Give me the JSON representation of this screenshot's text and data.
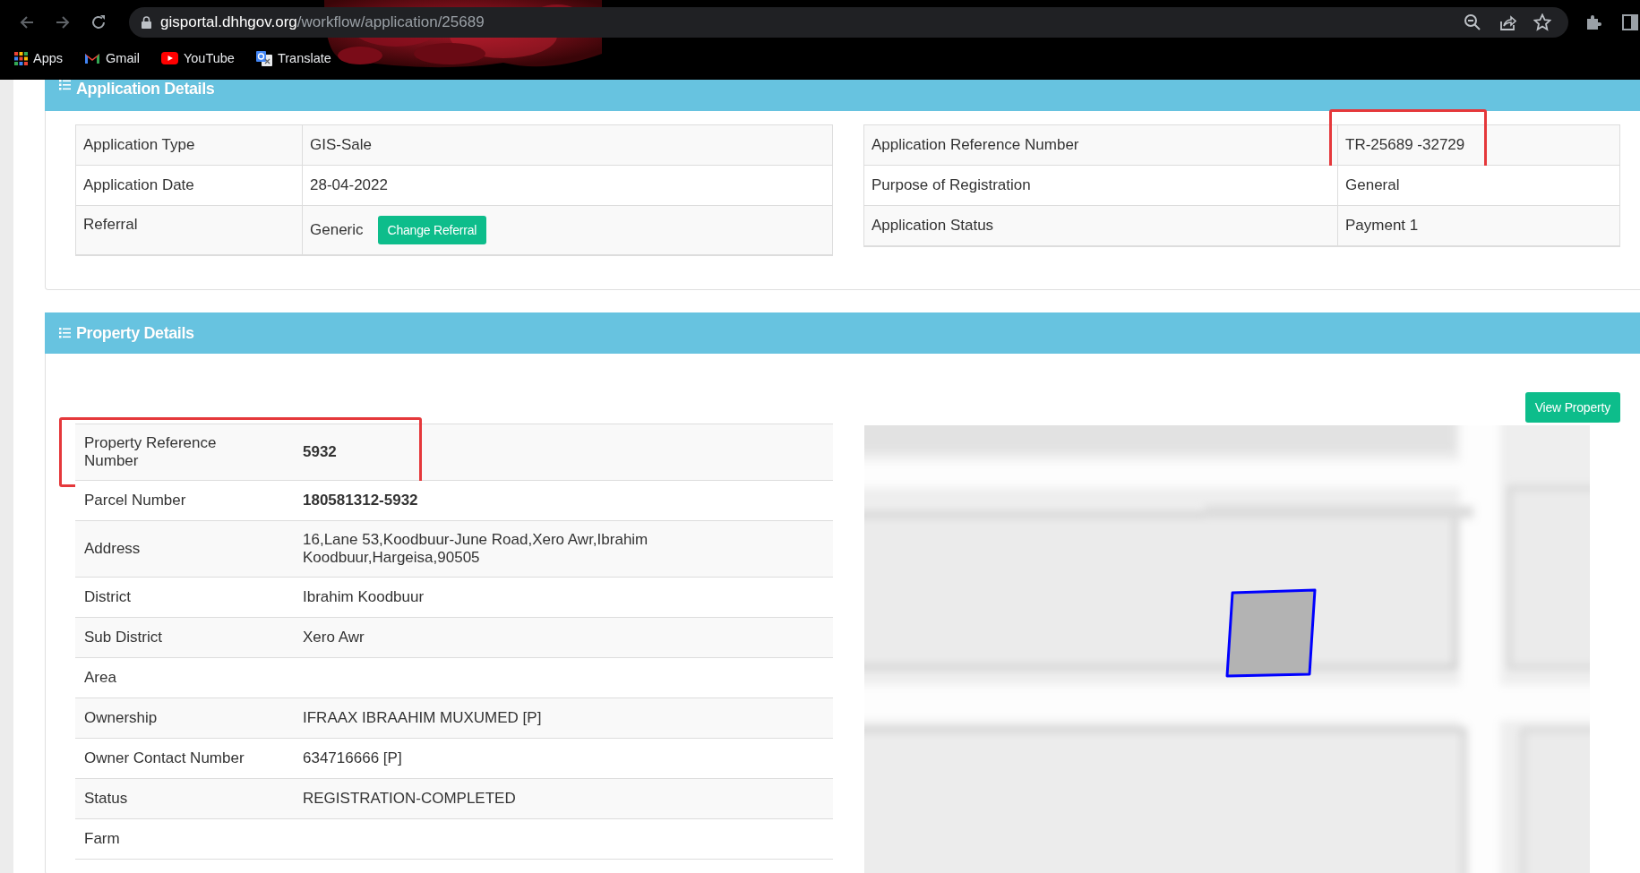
{
  "browser": {
    "url_domain": "gisportal.dhhgov.org",
    "url_path": "/workflow/application/25689",
    "bookmarks": [
      {
        "label": "Apps",
        "kind": "apps"
      },
      {
        "label": "Gmail",
        "kind": "gmail"
      },
      {
        "label": "YouTube",
        "kind": "youtube"
      },
      {
        "label": "Translate",
        "kind": "translate"
      }
    ]
  },
  "application_details": {
    "title": "Application Details",
    "left_table": [
      {
        "label": "Application Type",
        "value": "GIS-Sale",
        "highlighted": false
      },
      {
        "label": "Application Date",
        "value": "28-04-2022",
        "highlighted": false
      },
      {
        "label": "Referral",
        "value": "Generic",
        "button": "Change Referral",
        "highlighted": false
      }
    ],
    "right_table": [
      {
        "label": "Application Reference Number",
        "value": "TR-25689 -32729",
        "highlighted": true
      },
      {
        "label": "Purpose of Registration",
        "value": "General",
        "highlighted": false
      },
      {
        "label": "Application Status",
        "value": "Payment 1",
        "highlighted": false
      }
    ]
  },
  "property_details": {
    "title": "Property Details",
    "view_button": "View Property",
    "rows": [
      {
        "label": "Property Reference Number",
        "value": "5932",
        "bold": true,
        "highlighted": true
      },
      {
        "label": "Parcel Number",
        "value": "180581312-5932",
        "bold": true,
        "highlighted": false
      },
      {
        "label": "Address",
        "value": "16,Lane 53,Koodbuur-June Road,Xero Awr,Ibrahim Koodbuur,Hargeisa,90505",
        "bold": false,
        "highlighted": false
      },
      {
        "label": "District",
        "value": "Ibrahim Koodbuur",
        "bold": false,
        "highlighted": false
      },
      {
        "label": "Sub District",
        "value": "Xero Awr",
        "bold": false,
        "highlighted": false
      },
      {
        "label": "Area",
        "bold": false,
        "highlighted": false
      },
      {
        "label": "Ownership",
        "value": "IFRAAX IBRAAHIM MUXUMED [P]",
        "bold": false,
        "highlighted": false
      },
      {
        "label": "Owner Contact Number",
        "value": "634716666 [P]",
        "bold": false,
        "highlighted": false
      },
      {
        "label": "Status",
        "value": "REGISTRATION-COMPLETED",
        "bold": false,
        "highlighted": false
      },
      {
        "label": "Farm",
        "bold": false,
        "highlighted": false
      }
    ]
  }
}
